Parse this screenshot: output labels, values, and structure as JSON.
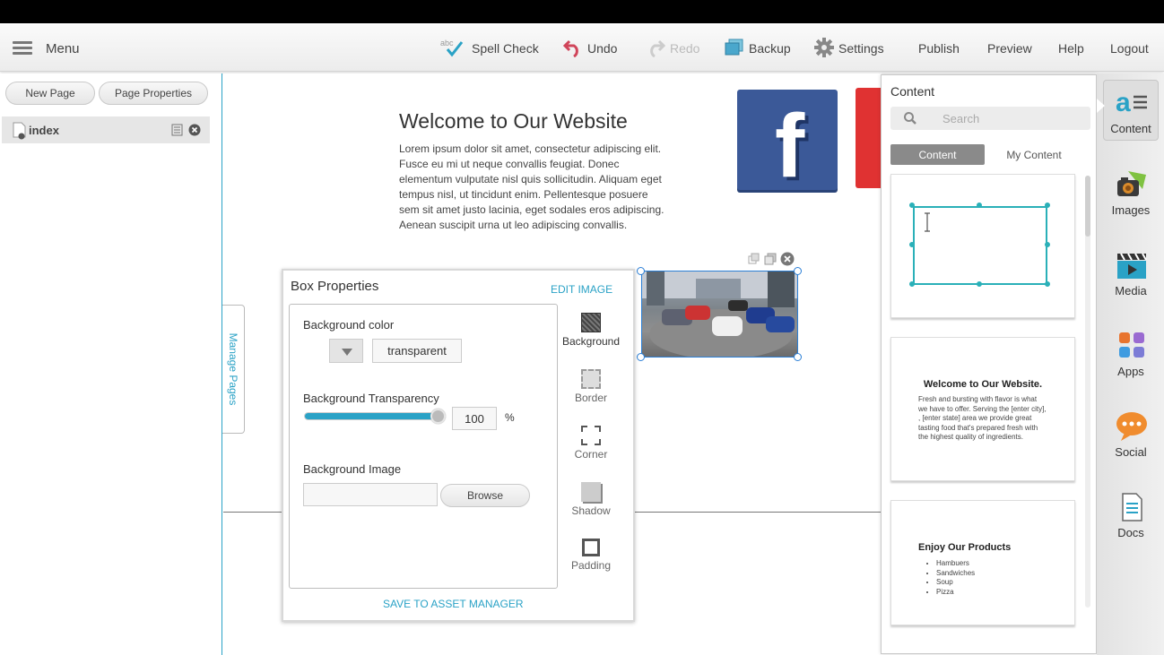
{
  "toolbar": {
    "menu_label": "Menu",
    "spell_check_label": "Spell Check",
    "undo_label": "Undo",
    "redo_label": "Redo",
    "backup_label": "Backup",
    "settings_label": "Settings",
    "publish_label": "Publish",
    "preview_label": "Preview",
    "help_label": "Help",
    "logout_label": "Logout"
  },
  "left_panel": {
    "new_page_label": "New Page",
    "page_properties_label": "Page Properties",
    "pages": [
      {
        "name": "index"
      }
    ],
    "manage_pages_label": "Manage Pages"
  },
  "canvas": {
    "title": "Welcome to Our Website",
    "body": "Lorem ipsum dolor sit amet, consectetur adipiscing elit. Fusce eu mi ut neque convallis feugiat. Donec elementum vulputate nisl quis sollicitudin. Aliquam eget tempus nisl, ut tincidunt enim. Pellentesque posuere sem sit amet justo lacinia, eget sodales eros adipiscing. Aenean suscipit urna ut leo adipiscing convallis.",
    "facebook_glyph": "f"
  },
  "box_properties": {
    "title": "Box Properties",
    "edit_image_label": "EDIT IMAGE",
    "background_color_label": "Background color",
    "background_color_value": "transparent",
    "transparency_label": "Background Transparency",
    "transparency_value": "100",
    "transparency_unit": "%",
    "background_image_label": "Background Image",
    "browse_label": "Browse",
    "save_label": "SAVE TO ASSET MANAGER",
    "side_options": [
      "Background",
      "Border",
      "Corner",
      "Shadow",
      "Padding"
    ]
  },
  "content_panel": {
    "title": "Content",
    "search_placeholder": "Search",
    "tab_content": "Content",
    "tab_my_content": "My Content",
    "thumb2_title": "Welcome to Our Website.",
    "thumb2_body": "Fresh and bursting with flavor is what we have to offer. Serving the [enter city], , [enter state] area we provide great tasting food that's prepared fresh with the highest quality of ingredients.",
    "thumb3_title": "Enjoy Our Products",
    "thumb3_items": [
      "Hambuers",
      "Sandwiches",
      "Soup",
      "Pizza"
    ]
  },
  "right_rail": {
    "items": [
      "Content",
      "Images",
      "Media",
      "Apps",
      "Social",
      "Docs"
    ]
  },
  "colors": {
    "accent": "#2aa2c6",
    "selection": "#2b7fd6",
    "facebook": "#3b5998"
  }
}
